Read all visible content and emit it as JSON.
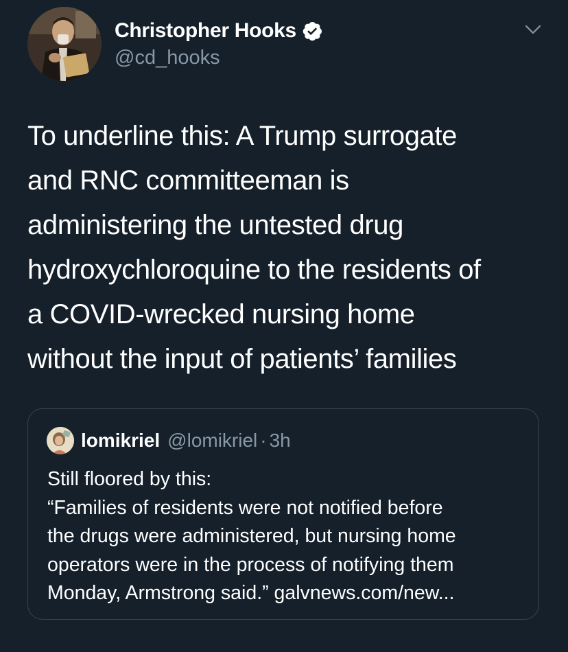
{
  "author": {
    "display_name": "Christopher Hooks",
    "handle": "@cd_hooks"
  },
  "tweet": {
    "lines": [
      "To underline this: A Trump surrogate",
      "and RNC committeeman is",
      "administering the untested drug",
      "hydroxychloroquine to the residents of",
      "a COVID-wrecked nursing home",
      "without the input of patients’ families"
    ]
  },
  "quoted_tweet": {
    "display_name": "lomikriel",
    "handle": "@lomikriel",
    "separator": "·",
    "time": "3h",
    "lines": [
      "Still floored by this:",
      "“Families of residents were not notified before",
      "the drugs were administered, but nursing home",
      "operators were in the process of notifying them",
      "Monday, Armstrong said.” galvnews.com/new..."
    ]
  },
  "icons": {
    "verified": "verified-badge-icon",
    "menu": "chevron-down-icon"
  },
  "colors": {
    "background": "#15202b",
    "text_primary": "#ffffff",
    "text_secondary": "#8899a6",
    "border": "#38444d"
  }
}
